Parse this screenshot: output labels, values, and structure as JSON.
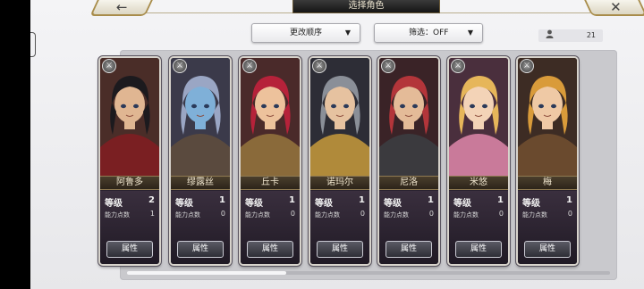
{
  "header": {
    "title": "选择角色",
    "back_icon": "←",
    "close_icon": "✕"
  },
  "toolbar": {
    "sort_label": "更改顺序",
    "filter_label": "筛选：OFF",
    "dropdown_caret": "▼",
    "person_icon": "👤",
    "character_count": "21"
  },
  "labels": {
    "level": "等级",
    "ability_points": "能力点数",
    "attribute_button": "属性"
  },
  "scroll": {
    "position_fraction": 0.0
  },
  "characters": [
    {
      "name": "阿鲁多",
      "level": "2",
      "points": "1",
      "weapon_icon": "⚔",
      "palette": {
        "hair": "#1c1a1e",
        "skin": "#e0b692",
        "cloth": "#7a1f22",
        "bg": "#4a2d28"
      }
    },
    {
      "name": "缪露丝",
      "level": "1",
      "points": "0",
      "weapon_icon": "⚔",
      "palette": {
        "hair": "#9aa6c4",
        "skin": "#7fb0d8",
        "cloth": "#5a4a3e",
        "bg": "#3b3a4a"
      }
    },
    {
      "name": "丘卡",
      "level": "1",
      "points": "0",
      "weapon_icon": "⚔",
      "palette": {
        "hair": "#b6223a",
        "skin": "#edc29c",
        "cloth": "#8a6a3a",
        "bg": "#4a2a2a"
      }
    },
    {
      "name": "诺玛尔",
      "level": "1",
      "points": "0",
      "weapon_icon": "⚔",
      "palette": {
        "hair": "#8a8f98",
        "skin": "#e6c2a0",
        "cloth": "#b08a3a",
        "bg": "#2d2d36"
      }
    },
    {
      "name": "尼洛",
      "level": "1",
      "points": "0",
      "weapon_icon": "⚔",
      "palette": {
        "hair": "#b3353a",
        "skin": "#e4bb98",
        "cloth": "#3b3a3e",
        "bg": "#3a2327"
      }
    },
    {
      "name": "米悠",
      "level": "1",
      "points": "0",
      "weapon_icon": "⚔",
      "palette": {
        "hair": "#e6b65a",
        "skin": "#f3d3b7",
        "cloth": "#c97a9a",
        "bg": "#4a2f3d"
      }
    },
    {
      "name": "梅",
      "level": "1",
      "points": "0",
      "weapon_icon": "⚔",
      "palette": {
        "hair": "#d99b3a",
        "skin": "#efc9a5",
        "cloth": "#6a4a2e",
        "bg": "#3d2c24"
      }
    }
  ],
  "colors": {
    "panel_bg": "#c9c9cd",
    "card_frame": "#d7d3cc",
    "accent_gold": "#a88c4a"
  }
}
